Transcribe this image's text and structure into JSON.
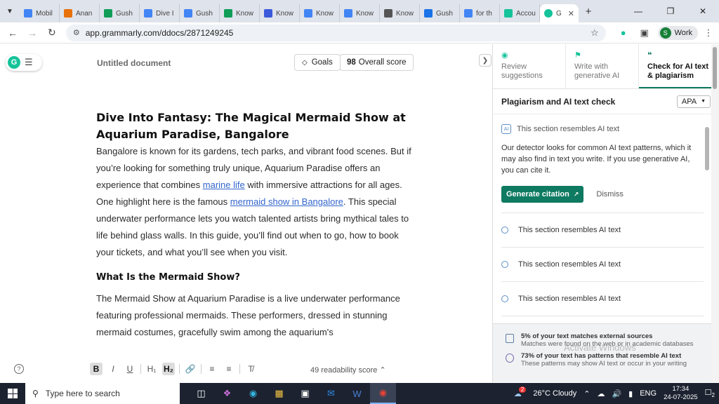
{
  "browser": {
    "tabs": [
      {
        "label": "Mobil",
        "color": "#4285f4"
      },
      {
        "label": "Anan",
        "color": "#e8710a"
      },
      {
        "label": "Gush",
        "color": "#0f9d58"
      },
      {
        "label": "Dive I",
        "color": "#4285f4"
      },
      {
        "label": "Gush",
        "color": "#4285f4"
      },
      {
        "label": "Know",
        "color": "#0f9d58"
      },
      {
        "label": "Know",
        "color": "#3b5bdb"
      },
      {
        "label": "Know",
        "color": "#4285f4"
      },
      {
        "label": "Know",
        "color": "#4285f4"
      },
      {
        "label": "Know",
        "color": "#555555"
      },
      {
        "label": "Gush",
        "color": "#1a73e8"
      },
      {
        "label": "for th",
        "color": "#4285f4"
      },
      {
        "label": "Accou",
        "color": "#15c39a"
      }
    ],
    "active_tab": {
      "label": "G",
      "color": "#15c39a"
    },
    "url": "app.grammarly.com/ddocs/2871249245",
    "profile_initial": "S",
    "profile_label": "Work"
  },
  "editor": {
    "doc_title": "Untitled document",
    "goals_label": "Goals",
    "score_value": "98",
    "score_label": "Overall score",
    "readability": "49 readability score"
  },
  "document": {
    "title": "Dive Into Fantasy: The Magical Mermaid Show at Aquarium Paradise, Bangalore",
    "p1_a": "Bangalore is known for its gardens, tech parks, and vibrant food scenes. But if you’re looking for something truly unique, Aquarium Paradise offers an experience that combines ",
    "p1_link": "marine life",
    "p1_b": " with immersive attractions for all ages.",
    "p2_a": "One highlight here is the famous ",
    "p2_link": "mermaid show in Bangalore",
    "p2_b": ". This special underwater performance lets you watch talented artists bring mythical tales to life behind glass walls. In this guide, you’ll find out when to go, how to book your tickets, and what you’ll see when you visit.",
    "h2": "What Is the Mermaid Show?",
    "p3": "The Mermaid Show at Aquarium Paradise is a live underwater performance featuring professional mermaids. These performers, dressed in stunning mermaid costumes, gracefully swim among the aquarium's"
  },
  "panel": {
    "tabs": [
      {
        "label": "Review suggestions"
      },
      {
        "label": "Write with generative AI"
      },
      {
        "label": "Check for AI text & plagiarism"
      }
    ],
    "header": "Plagiarism and AI text check",
    "style": "APA",
    "card_title": "This section resembles AI text",
    "card_body": "Our detector looks for common AI text patterns, which it may also find in text you write. If you use generative AI, you can cite it.",
    "generate_label": "Generate citation",
    "dismiss_label": "Dismiss",
    "items": [
      {
        "label": "This section resembles AI text"
      },
      {
        "label": "This section resembles AI text"
      },
      {
        "label": "This section resembles AI text"
      }
    ],
    "footer": [
      {
        "title": "5% of your text matches external sources",
        "sub": "Matches were found on the web or in academic databases"
      },
      {
        "title": "73% of your text has patterns that resemble AI text",
        "sub": "These patterns may show AI text or occur in your writing"
      }
    ],
    "watermark": "Activate Windows"
  },
  "taskbar": {
    "search_placeholder": "Type here to search",
    "weather": "26°C  Cloudy",
    "weather_badge": "2",
    "lang": "ENG",
    "time": "17:34",
    "date": "24-07-2025",
    "notif_count": "2"
  }
}
